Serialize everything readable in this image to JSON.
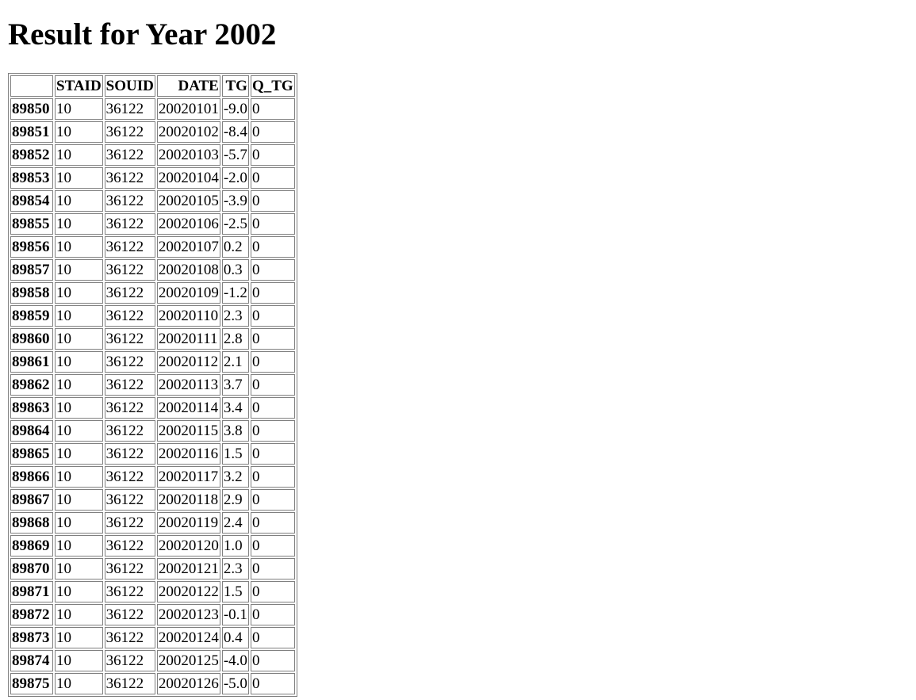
{
  "page": {
    "title": "Result for Year 2002"
  },
  "table": {
    "corner": "",
    "columns": [
      "STAID",
      "SOUID",
      "DATE",
      "TG",
      "Q_TG"
    ],
    "rows": [
      {
        "index": "89850",
        "staid": "10",
        "souid": "36122",
        "date": "20020101",
        "tg": "-9.0",
        "q_tg": "0"
      },
      {
        "index": "89851",
        "staid": "10",
        "souid": "36122",
        "date": "20020102",
        "tg": "-8.4",
        "q_tg": "0"
      },
      {
        "index": "89852",
        "staid": "10",
        "souid": "36122",
        "date": "20020103",
        "tg": "-5.7",
        "q_tg": "0"
      },
      {
        "index": "89853",
        "staid": "10",
        "souid": "36122",
        "date": "20020104",
        "tg": "-2.0",
        "q_tg": "0"
      },
      {
        "index": "89854",
        "staid": "10",
        "souid": "36122",
        "date": "20020105",
        "tg": "-3.9",
        "q_tg": "0"
      },
      {
        "index": "89855",
        "staid": "10",
        "souid": "36122",
        "date": "20020106",
        "tg": "-2.5",
        "q_tg": "0"
      },
      {
        "index": "89856",
        "staid": "10",
        "souid": "36122",
        "date": "20020107",
        "tg": "0.2",
        "q_tg": "0"
      },
      {
        "index": "89857",
        "staid": "10",
        "souid": "36122",
        "date": "20020108",
        "tg": "0.3",
        "q_tg": "0"
      },
      {
        "index": "89858",
        "staid": "10",
        "souid": "36122",
        "date": "20020109",
        "tg": "-1.2",
        "q_tg": "0"
      },
      {
        "index": "89859",
        "staid": "10",
        "souid": "36122",
        "date": "20020110",
        "tg": "2.3",
        "q_tg": "0"
      },
      {
        "index": "89860",
        "staid": "10",
        "souid": "36122",
        "date": "20020111",
        "tg": "2.8",
        "q_tg": "0"
      },
      {
        "index": "89861",
        "staid": "10",
        "souid": "36122",
        "date": "20020112",
        "tg": "2.1",
        "q_tg": "0"
      },
      {
        "index": "89862",
        "staid": "10",
        "souid": "36122",
        "date": "20020113",
        "tg": "3.7",
        "q_tg": "0"
      },
      {
        "index": "89863",
        "staid": "10",
        "souid": "36122",
        "date": "20020114",
        "tg": "3.4",
        "q_tg": "0"
      },
      {
        "index": "89864",
        "staid": "10",
        "souid": "36122",
        "date": "20020115",
        "tg": "3.8",
        "q_tg": "0"
      },
      {
        "index": "89865",
        "staid": "10",
        "souid": "36122",
        "date": "20020116",
        "tg": "1.5",
        "q_tg": "0"
      },
      {
        "index": "89866",
        "staid": "10",
        "souid": "36122",
        "date": "20020117",
        "tg": "3.2",
        "q_tg": "0"
      },
      {
        "index": "89867",
        "staid": "10",
        "souid": "36122",
        "date": "20020118",
        "tg": "2.9",
        "q_tg": "0"
      },
      {
        "index": "89868",
        "staid": "10",
        "souid": "36122",
        "date": "20020119",
        "tg": "2.4",
        "q_tg": "0"
      },
      {
        "index": "89869",
        "staid": "10",
        "souid": "36122",
        "date": "20020120",
        "tg": "1.0",
        "q_tg": "0"
      },
      {
        "index": "89870",
        "staid": "10",
        "souid": "36122",
        "date": "20020121",
        "tg": "2.3",
        "q_tg": "0"
      },
      {
        "index": "89871",
        "staid": "10",
        "souid": "36122",
        "date": "20020122",
        "tg": "1.5",
        "q_tg": "0"
      },
      {
        "index": "89872",
        "staid": "10",
        "souid": "36122",
        "date": "20020123",
        "tg": "-0.1",
        "q_tg": "0"
      },
      {
        "index": "89873",
        "staid": "10",
        "souid": "36122",
        "date": "20020124",
        "tg": "0.4",
        "q_tg": "0"
      },
      {
        "index": "89874",
        "staid": "10",
        "souid": "36122",
        "date": "20020125",
        "tg": "-4.0",
        "q_tg": "0"
      },
      {
        "index": "89875",
        "staid": "10",
        "souid": "36122",
        "date": "20020126",
        "tg": "-5.0",
        "q_tg": "0"
      }
    ]
  }
}
